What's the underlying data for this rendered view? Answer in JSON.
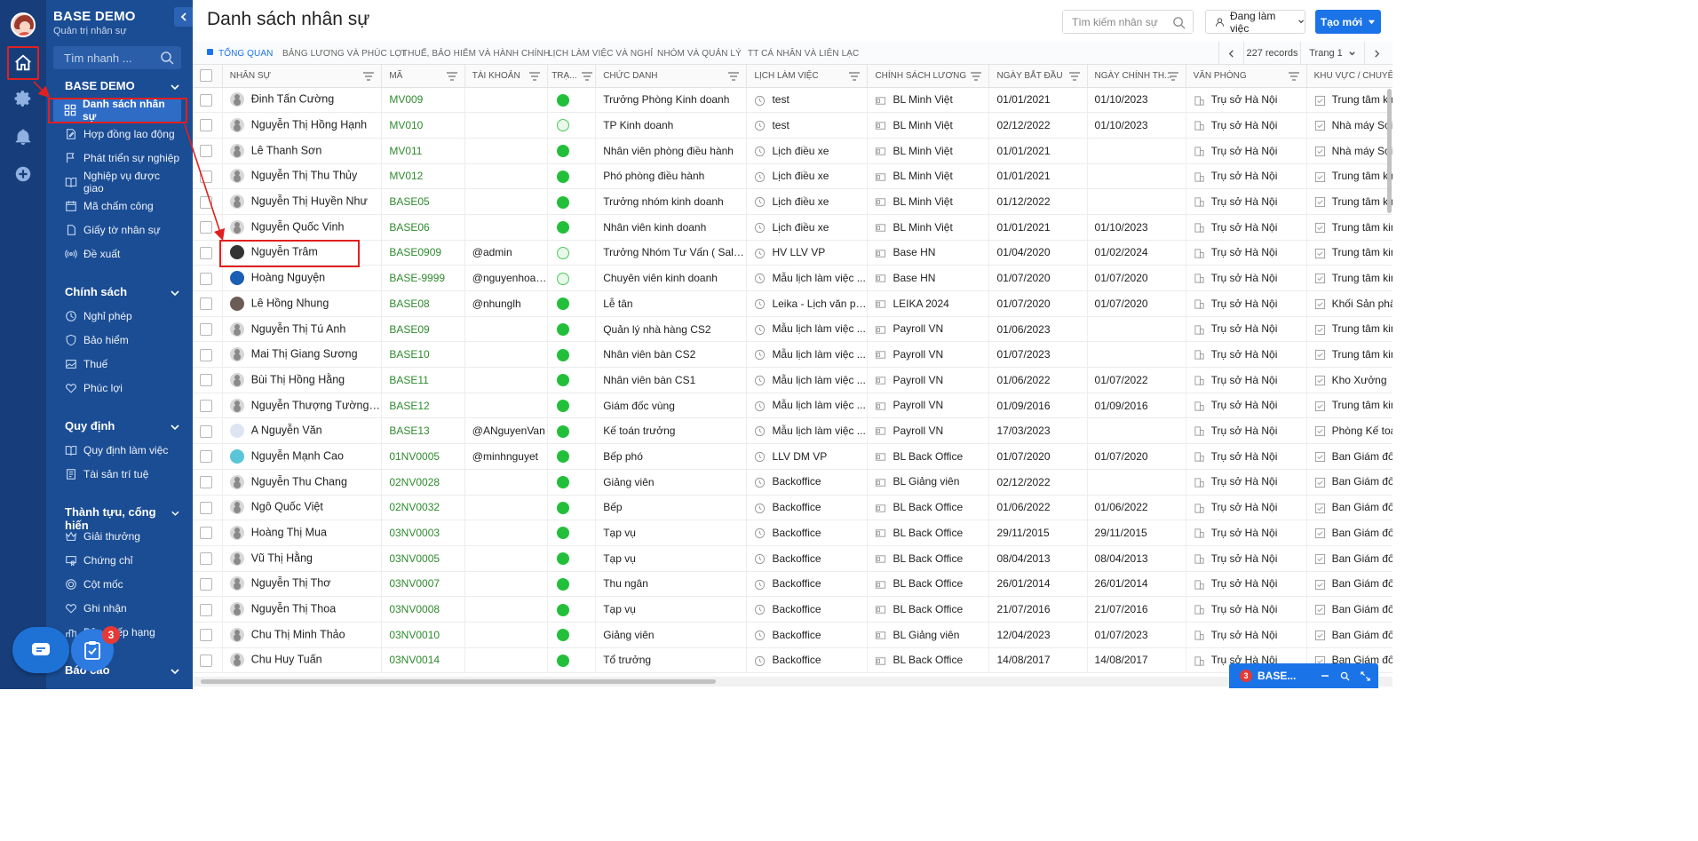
{
  "brand": {
    "title": "BASE DEMO",
    "subtitle": "Quản trị nhân sự",
    "search_placeholder": "Tìm nhanh ..."
  },
  "sidebar": {
    "section1": {
      "title": "BASE DEMO",
      "items": [
        "Danh sách nhân sự",
        "Hợp đồng lao động",
        "Phát triển sự nghiệp",
        "Nghiệp vụ được giao",
        "Mã chấm công",
        "Giấy tờ nhân sự",
        "Đề xuất"
      ]
    },
    "section2": {
      "title": "Chính sách",
      "items": [
        "Nghỉ phép",
        "Bảo hiểm",
        "Thuế",
        "Phúc lợi"
      ]
    },
    "section3": {
      "title": "Quy định",
      "items": [
        "Quy định làm việc",
        "Tài sản trí tuệ"
      ]
    },
    "section4": {
      "title": "Thành tựu, cống hiến",
      "items": [
        "Giải thưởng",
        "Chứng chỉ",
        "Cột mốc",
        "Ghi nhận",
        "Bảng xếp hạng"
      ]
    },
    "section5": {
      "title": "Báo cáo"
    },
    "task_badge": "3"
  },
  "header": {
    "title": "Danh sách nhân sự",
    "search_placeholder": "Tìm kiếm nhân sự",
    "status": "Đang làm việc",
    "create": "Tạo mới"
  },
  "tabs": [
    "Tổng quan",
    "Bảng lương và phúc lợi",
    "Thuế, bảo hiểm và hành chính",
    "Lịch làm việc và nghỉ",
    "Nhóm và quản lý",
    "TT cá nhân và liên lạc"
  ],
  "pager": {
    "records": "227 records",
    "page": "Trang 1"
  },
  "columns": [
    "Nhân sự",
    "Mã",
    "Tài khoản",
    "Trạ...",
    "Chức danh",
    "Lịch làm việc",
    "Chính sách lương",
    "Ngày bắt đầu",
    "Ngày chính th...",
    "Văn phòng",
    "Khu vực / chuyên m..."
  ],
  "rows": [
    {
      "name": "Đinh Tấn Cường",
      "code": "MV009",
      "account": "",
      "status": "full",
      "title": "Trưởng Phòng Kinh doanh",
      "schedule": "test",
      "policy": "BL Minh Việt",
      "start": "01/01/2021",
      "official": "01/10/2023",
      "office": "Trụ sở Hà Nội",
      "area": "Trung tâm kinh do...",
      "avatar": "gray"
    },
    {
      "name": "Nguyễn Thị Hồng Hạnh",
      "code": "MV010",
      "account": "",
      "status": "hollow",
      "title": "TP Kinh doanh",
      "schedule": "test",
      "policy": "BL Minh Việt",
      "start": "02/12/2022",
      "official": "01/10/2023",
      "office": "Trụ sở Hà Nội",
      "area": "Nhà máy Sợi",
      "avatar": "gray"
    },
    {
      "name": "Lê Thanh Sơn",
      "code": "MV011",
      "account": "",
      "status": "full",
      "title": "Nhân viên phòng điều hành",
      "schedule": "Lịch điều xe",
      "policy": "BL Minh Việt",
      "start": "01/01/2021",
      "official": "",
      "office": "Trụ sở Hà Nội",
      "area": "Nhà máy Sợi",
      "avatar": "gray"
    },
    {
      "name": "Nguyễn Thị Thu Thủy",
      "code": "MV012",
      "account": "",
      "status": "full",
      "title": "Phó phòng điều hành",
      "schedule": "Lịch điều xe",
      "policy": "BL Minh Việt",
      "start": "01/01/2021",
      "official": "",
      "office": "Trụ sở Hà Nội",
      "area": "Trung tâm kinh do...",
      "avatar": "gray"
    },
    {
      "name": "Nguyễn Thị Huyền Như",
      "code": "BASE05",
      "account": "",
      "status": "full",
      "title": "Trưởng nhóm kinh doanh",
      "schedule": "Lịch điều xe",
      "policy": "BL Minh Việt",
      "start": "01/12/2022",
      "official": "",
      "office": "Trụ sở Hà Nội",
      "area": "Trung tâm kinh do...",
      "avatar": "gray"
    },
    {
      "name": "Nguyễn Quốc Vinh",
      "code": "BASE06",
      "account": "",
      "status": "full",
      "title": "Nhân viên kinh doanh",
      "schedule": "Lịch điều xe",
      "policy": "BL Minh Việt",
      "start": "01/01/2021",
      "official": "01/10/2023",
      "office": "Trụ sở Hà Nội",
      "area": "Trung tâm kinh do...",
      "avatar": "gray"
    },
    {
      "name": "Nguyễn Trâm",
      "code": "BASE0909",
      "account": "@admin",
      "status": "hollow",
      "title": "Trưởng Nhóm Tư Vấn ( Sales ...",
      "schedule": "HV LLV VP",
      "policy": "Base HN",
      "start": "01/04/2020",
      "official": "01/02/2024",
      "office": "Trụ sở Hà Nội",
      "area": "Trung tâm kinh do...",
      "avatar": "dark"
    },
    {
      "name": "Hoàng Nguyện",
      "code": "BASE-9999",
      "account": "@nguyenhoang",
      "status": "hollow",
      "title": "Chuyên viên kinh doanh",
      "schedule": "Mẫu lịch làm việc ...",
      "policy": "Base HN",
      "start": "01/07/2020",
      "official": "01/07/2020",
      "office": "Trụ sở Hà Nội",
      "area": "Trung tâm kinh do...",
      "avatar": "blue"
    },
    {
      "name": "Lê Hồng Nhung",
      "code": "BASE08",
      "account": "@nhunglh",
      "status": "full",
      "title": "Lễ tân",
      "schedule": "Leika - Lịch văn ph...",
      "policy": "LEIKA 2024",
      "start": "01/07/2020",
      "official": "01/07/2020",
      "office": "Trụ sở Hà Nội",
      "area": "Khối Sản phẩm",
      "avatar": "photo"
    },
    {
      "name": "Nguyễn Thị Tú Anh",
      "code": "BASE09",
      "account": "",
      "status": "full",
      "title": "Quản lý nhà hàng CS2",
      "schedule": "Mẫu lịch làm việc ...",
      "policy": "Payroll VN",
      "start": "01/06/2023",
      "official": "",
      "office": "Trụ sở Hà Nội",
      "area": "Trung tâm kinh do...",
      "avatar": "gray"
    },
    {
      "name": "Mai Thị Giang Sương",
      "code": "BASE10",
      "account": "",
      "status": "full",
      "title": "Nhân viên bàn CS2",
      "schedule": "Mẫu lịch làm việc ...",
      "policy": "Payroll VN",
      "start": "01/07/2023",
      "official": "",
      "office": "Trụ sở Hà Nội",
      "area": "Trung tâm kinh do...",
      "avatar": "gray"
    },
    {
      "name": "Bùi Thị Hồng Hằng",
      "code": "BASE11",
      "account": "",
      "status": "full",
      "title": "Nhân viên bàn CS1",
      "schedule": "Mẫu lịch làm việc ...",
      "policy": "Payroll VN",
      "start": "01/06/2022",
      "official": "01/07/2022",
      "office": "Trụ sở Hà Nội",
      "area": "Kho Xưởng",
      "avatar": "gray"
    },
    {
      "name": "Nguyễn Thượng Tường ...",
      "code": "BASE12",
      "account": "",
      "status": "full",
      "title": "Giám đốc vùng",
      "schedule": "Mẫu lịch làm việc ...",
      "policy": "Payroll VN",
      "start": "01/09/2016",
      "official": "01/09/2016",
      "office": "Trụ sở Hà Nội",
      "area": "Trung tâm kinh do...",
      "avatar": "gray"
    },
    {
      "name": "A Nguyễn Văn",
      "code": "BASE13",
      "account": "@ANguyenVan",
      "status": "full",
      "title": "Kế toán trưởng",
      "schedule": "Mẫu lịch làm việc ...",
      "policy": "Payroll VN",
      "start": "17/03/2023",
      "official": "",
      "office": "Trụ sở Hà Nội",
      "area": "Phòng Kế toán - T...",
      "avatar": "light"
    },
    {
      "name": "Nguyễn Mạnh Cao",
      "code": "01NV0005",
      "account": "@minhnguyet",
      "status": "full",
      "title": "Bếp phó",
      "schedule": "LLV DM VP",
      "policy": "BL Back Office",
      "start": "01/07/2020",
      "official": "01/07/2020",
      "office": "Trụ sở Hà Nội",
      "area": "Ban Giám đốc",
      "avatar": "teal"
    },
    {
      "name": "Nguyễn Thu Chang",
      "code": "02NV0028",
      "account": "",
      "status": "full",
      "title": "Giảng viên",
      "schedule": "Backoffice",
      "policy": "BL Giảng viên",
      "start": "02/12/2022",
      "official": "",
      "office": "Trụ sở Hà Nội",
      "area": "Ban Giám đốc",
      "avatar": "gray"
    },
    {
      "name": "Ngô Quốc Việt",
      "code": "02NV0032",
      "account": "",
      "status": "full",
      "title": "Bếp",
      "schedule": "Backoffice",
      "policy": "BL Back Office",
      "start": "01/06/2022",
      "official": "01/06/2022",
      "office": "Trụ sở Hà Nội",
      "area": "Ban Giám đốc",
      "avatar": "gray"
    },
    {
      "name": "Hoàng Thị Mua",
      "code": "03NV0003",
      "account": "",
      "status": "full",
      "title": "Tạp vụ",
      "schedule": "Backoffice",
      "policy": "BL Back Office",
      "start": "29/11/2015",
      "official": "29/11/2015",
      "office": "Trụ sở Hà Nội",
      "area": "Ban Giám đốc",
      "avatar": "gray"
    },
    {
      "name": "Vũ Thị Hằng",
      "code": "03NV0005",
      "account": "",
      "status": "full",
      "title": "Tạp vụ",
      "schedule": "Backoffice",
      "policy": "BL Back Office",
      "start": "08/04/2013",
      "official": "08/04/2013",
      "office": "Trụ sở Hà Nội",
      "area": "Ban Giám đốc",
      "avatar": "gray"
    },
    {
      "name": "Nguyễn Thị Thơ",
      "code": "03NV0007",
      "account": "",
      "status": "full",
      "title": "Thu ngân",
      "schedule": "Backoffice",
      "policy": "BL Back Office",
      "start": "26/01/2014",
      "official": "26/01/2014",
      "office": "Trụ sở Hà Nội",
      "area": "Ban Giám đốc",
      "avatar": "gray"
    },
    {
      "name": "Nguyễn Thị Thoa",
      "code": "03NV0008",
      "account": "",
      "status": "full",
      "title": "Tạp vụ",
      "schedule": "Backoffice",
      "policy": "BL Back Office",
      "start": "21/07/2016",
      "official": "21/07/2016",
      "office": "Trụ sở Hà Nội",
      "area": "Ban Giám đốc",
      "avatar": "gray"
    },
    {
      "name": "Chu Thị Minh Thảo",
      "code": "03NV0010",
      "account": "",
      "status": "full",
      "title": "Giảng viên",
      "schedule": "Backoffice",
      "policy": "BL Giảng viên",
      "start": "12/04/2023",
      "official": "01/07/2023",
      "office": "Trụ sở Hà Nội",
      "area": "Ban Giám đốc",
      "avatar": "gray"
    },
    {
      "name": "Chu Huy Tuấn",
      "code": "03NV0014",
      "account": "",
      "status": "full",
      "title": "Tổ trưởng",
      "schedule": "Backoffice",
      "policy": "BL Back Office",
      "start": "14/08/2017",
      "official": "14/08/2017",
      "office": "Trụ sở Hà Nội",
      "area": "Ban Giám đốc",
      "avatar": "gray"
    }
  ],
  "chat": {
    "label": "BASE...",
    "badge": "3"
  }
}
